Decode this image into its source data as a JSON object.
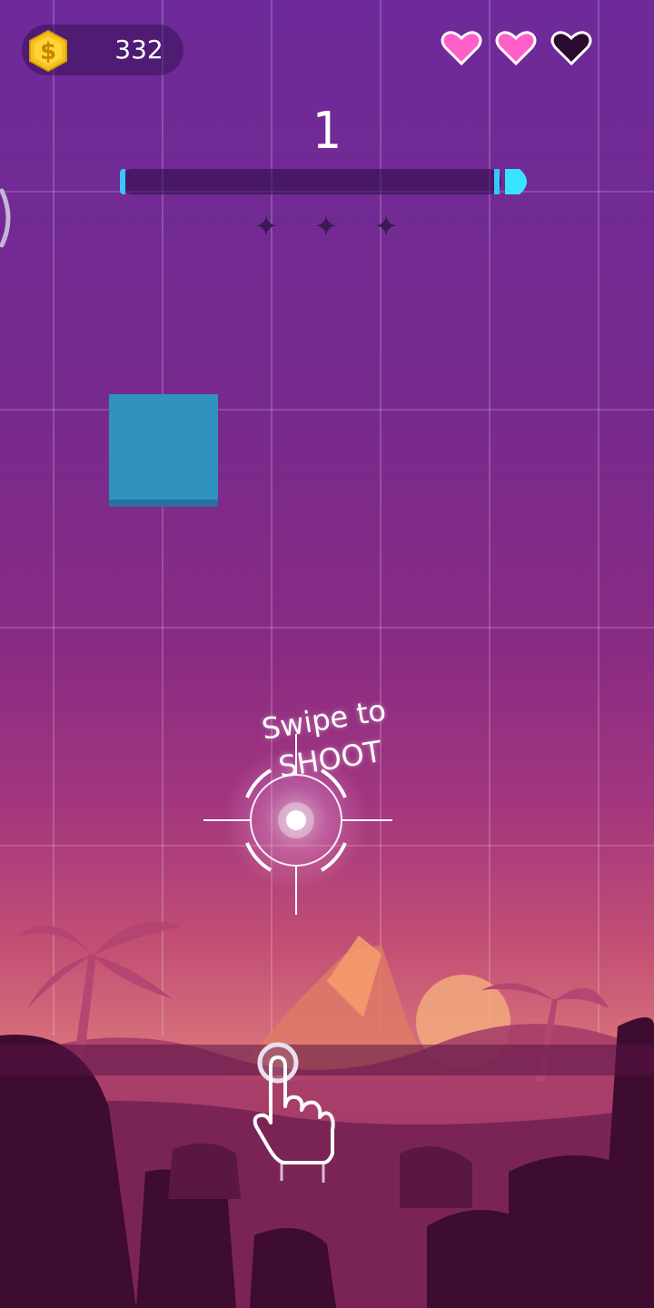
{
  "hud": {
    "coins": "332",
    "level": "1",
    "hearts": [
      {
        "state": "full",
        "color": "#ff5fc8"
      },
      {
        "state": "full",
        "color": "#ff5fc8"
      },
      {
        "state": "empty",
        "color": "#2a0a2e"
      }
    ],
    "progress_percent": 98,
    "stars_earned": 0,
    "stars_total": 3
  },
  "hint": {
    "text": "Swipe to SHOOT"
  },
  "icons": {
    "coin": "coin-icon",
    "heart": "heart-icon",
    "star": "star-icon",
    "crosshair": "crosshair-icon",
    "hand": "tap-hand-icon"
  },
  "colors": {
    "coin": "#f5c21b",
    "progress_accent": "#39c6ff",
    "block": "#2f92bf",
    "heart_full": "#ff5fc8"
  }
}
